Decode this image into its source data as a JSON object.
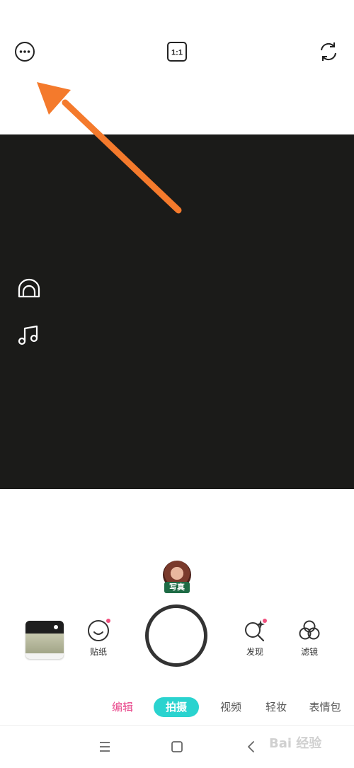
{
  "top_bar": {
    "more_icon": "ellipsis-circle-icon",
    "ratio_label": "1:1",
    "flip_icon": "camera-flip-icon"
  },
  "viewfinder": {
    "background": "#1b1b19",
    "side_icons": [
      "beauty-face-icon",
      "music-note-icon"
    ]
  },
  "annotation": {
    "color": "#f47a2c"
  },
  "template": {
    "tag": "写真"
  },
  "controls": {
    "sticker_label": "贴纸",
    "discover_label": "发现",
    "filter_label": "滤镜",
    "new_dot_color": "#f04f7d"
  },
  "modes": {
    "edit": "编辑",
    "shoot": "拍摄",
    "video": "视频",
    "makeup": "轻妆",
    "emoji": "表情包",
    "active": "拍摄",
    "active_color": "#2ad3cf",
    "edit_color": "#e8468a"
  },
  "system_nav": {
    "icons": [
      "menu-icon",
      "home-square-icon",
      "back-chevron-icon"
    ],
    "watermark": "Bai 经验"
  }
}
